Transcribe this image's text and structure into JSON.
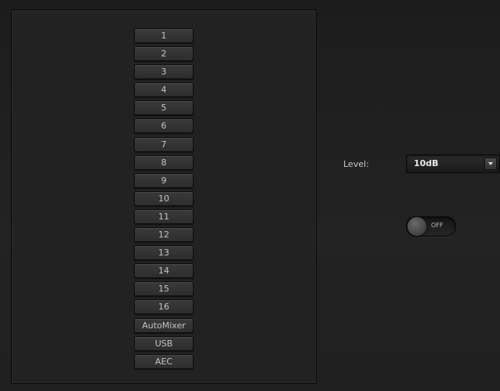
{
  "channels": [
    "1",
    "2",
    "3",
    "4",
    "5",
    "6",
    "7",
    "8",
    "9",
    "10",
    "11",
    "12",
    "13",
    "14",
    "15",
    "16",
    "AutoMixer",
    "USB",
    "AEC"
  ],
  "level": {
    "label": "Level:",
    "value": "10dB"
  },
  "toggle": {
    "state": "OFF"
  }
}
